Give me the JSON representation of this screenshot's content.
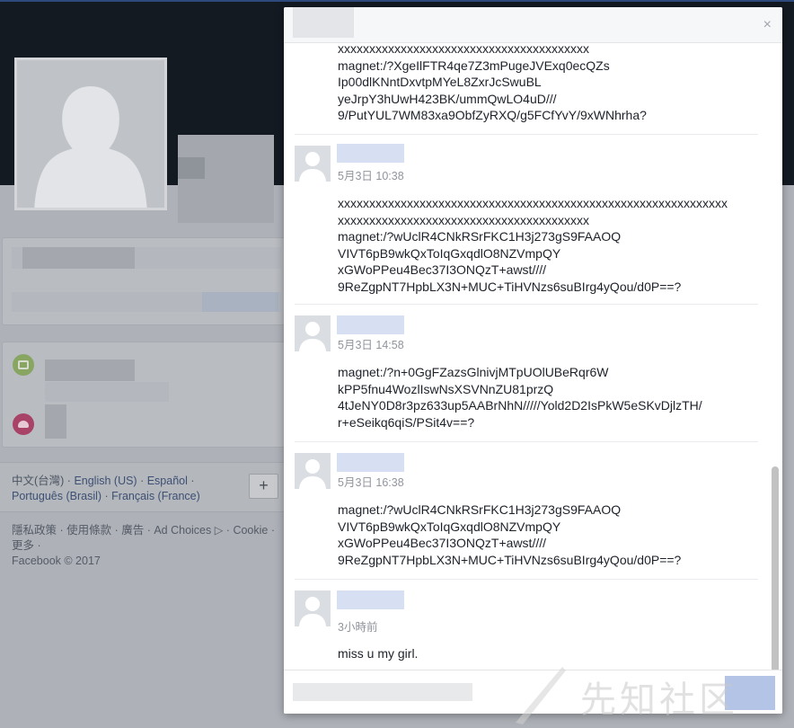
{
  "background": {
    "languages": [
      "中文(台灣)",
      "English (US)",
      "Español",
      "Português (Brasil)",
      "Français (France)"
    ],
    "lang_plus": "+",
    "footer_line1": "隱私政策 · 使用條款 · 廣告 · Ad Choices ▷ · Cookie ·",
    "footer_line2": "更多 ·",
    "footer_copyright": "Facebook © 2017"
  },
  "modal": {
    "close_icon": "×",
    "first_body": "xxxxxxxxxxxxxxxxxxxxxxxxxxxxxxxxxxxxxxxx\nmagnet:/?XgeIlFTR4qe7Z3mPugeJVExq0ecQZs\nIp00dlKNntDxvtpMYeL8ZxrJcSwuBL\nyeJrpY3hUwH423BK/ummQwLO4uD///\n9/PutYUL7WM83xa9ObfZyRXQ/g5FCfYvY/9xWNhrha?",
    "messages": [
      {
        "time": "5月3日 10:38",
        "body": "xxxxxxxxxxxxxxxxxxxxxxxxxxxxxxxxxxxxxxxxxxxxxxxxxxxxxxxxxxxxxx\nxxxxxxxxxxxxxxxxxxxxxxxxxxxxxxxxxxxxxxxx\nmagnet:/?wUclR4CNkRSrFKC1H3j273gS9FAAOQ\nVIVT6pB9wkQxToIqGxqdlO8NZVmpQY\nxGWoPPeu4Bec37I3ONQzT+awst////\n9ReZgpNT7HpbLX3N+MUC+TiHVNzs6suBIrg4yQou/d0P==?"
      },
      {
        "time": "5月3日 14:58",
        "body": "magnet:/?n+0GgFZazsGlnivjMTpUOlUBeRqr6W\nkPP5fnu4WozlIswNsXSVNnZU81przQ\n4tJeNY0D8r3pz633up5AABrNhN/////Yold2D2IsPkW5eSKvDjlzTH/\nr+eSeikq6qiS/PSit4v==?"
      },
      {
        "time": "5月3日 16:38",
        "body": "magnet:/?wUclR4CNkRSrFKC1H3j273gS9FAAOQ\nVIVT6pB9wkQxToIqGxqdlO8NZVmpQY\nxGWoPPeu4Bec37I3ONQzT+awst////\n9ReZgpNT7HpbLX3N+MUC+TiHVNzs6suBIrg4yQou/d0P==?"
      },
      {
        "time": "3小時前",
        "body": "miss u my girl."
      }
    ]
  },
  "watermark": "先知社区"
}
